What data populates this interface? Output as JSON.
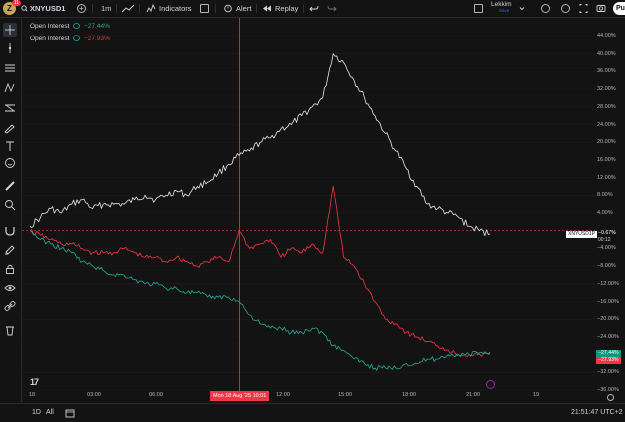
{
  "toolbar": {
    "logo_letter": "Z",
    "notification_count": "11",
    "symbol": "XNYUSD1",
    "add_symbol": "+",
    "interval": "1m",
    "indicators_label": "Indicators",
    "alert_label": "Alert",
    "replay_label": "Replay",
    "layout_name": "Lekkim",
    "layout_status": "Save",
    "publish_label": "Pu"
  },
  "legend": [
    {
      "name": "Open Interest",
      "value": "−27.44%",
      "color": "#22ab94"
    },
    {
      "name": "Open Interest",
      "value": "−27.93%",
      "color": "#f23645"
    }
  ],
  "price_scale": {
    "ticks": [
      "44.00%",
      "40.00%",
      "36.00%",
      "32.00%",
      "28.00%",
      "24.00%",
      "20.00%",
      "16.00%",
      "12.00%",
      "8.00%",
      "4.00%",
      "−4.00%",
      "−8.00%",
      "−12.00%",
      "−16.00%",
      "−20.00%",
      "−24.00%",
      "−32.00%",
      "−36.00%"
    ],
    "symbol_tag": "XNYUSD1P",
    "symbol_value": "−0.67%",
    "countdown": "00:12",
    "tag_green": "−27.44%",
    "tag_red": "−27.93%"
  },
  "time_scale": {
    "ticks": [
      "18",
      "03:00",
      "06:00",
      "12:00",
      "15:00",
      "18:00",
      "21:00",
      "19"
    ],
    "crosshair_label": "Mon 18 Aug '25   10:01"
  },
  "bottom": {
    "range_1d": "1D",
    "range_all": "All",
    "clock": "21:51:47 UTC+2"
  },
  "colors": {
    "background": "#131313",
    "white_series": "#e8e8e8",
    "red_series": "#f23645",
    "green_series": "#22ab94",
    "crosshair": "#f23645"
  },
  "chart_data": {
    "type": "line",
    "x": [
      "00:00",
      "00:30",
      "01:00",
      "01:30",
      "02:00",
      "02:30",
      "03:00",
      "03:30",
      "04:00",
      "04:30",
      "05:00",
      "05:30",
      "06:00",
      "06:30",
      "07:00",
      "07:30",
      "08:00",
      "08:30",
      "09:00",
      "09:30",
      "10:00",
      "10:30",
      "11:00",
      "11:30",
      "12:00",
      "12:30",
      "13:00",
      "13:30",
      "14:00",
      "14:30",
      "15:00",
      "15:30",
      "16:00",
      "16:30",
      "17:00",
      "17:30",
      "18:00",
      "18:30",
      "19:00",
      "19:30",
      "20:00",
      "20:30",
      "21:00",
      "21:30",
      "21:50"
    ],
    "series": [
      {
        "name": "XNYUSD1",
        "color": "#e8e8e8",
        "values": [
          1,
          3,
          5,
          4,
          6,
          7,
          5,
          6,
          6,
          6,
          7,
          8,
          7,
          8,
          9,
          8,
          10,
          11,
          13,
          15,
          17,
          18,
          20,
          21,
          23,
          24,
          26,
          28,
          30,
          40,
          38,
          34,
          30,
          26,
          22,
          18,
          14,
          10,
          6,
          5,
          4,
          3,
          1,
          0,
          -0.7
        ]
      },
      {
        "name": "Open Interest",
        "color": "#f23645",
        "values": [
          0,
          -1,
          -2,
          -3,
          -3,
          -4,
          -5,
          -5,
          -5,
          -4,
          -5,
          -6,
          -6,
          -7,
          -6,
          -7,
          -8,
          -7,
          -6,
          -7,
          0,
          -4,
          -3,
          -2,
          -6,
          -4,
          -5,
          -3,
          -5,
          10,
          -6,
          -8,
          -12,
          -16,
          -20,
          -21,
          -23,
          -24,
          -25,
          -26,
          -27,
          -28,
          -28,
          -28,
          -27.93
        ]
      },
      {
        "name": "Open Interest",
        "color": "#22ab94",
        "values": [
          0,
          -2,
          -3,
          -4,
          -5,
          -7,
          -8,
          -9,
          -10,
          -10,
          -11,
          -12,
          -12,
          -13,
          -13,
          -14,
          -14,
          -15,
          -15,
          -15,
          -16,
          -19,
          -21,
          -22,
          -22,
          -23,
          -23,
          -22,
          -23,
          -26,
          -27,
          -29,
          -30,
          -31,
          -31,
          -31,
          -30,
          -30,
          -29,
          -29,
          -28,
          -28,
          -28,
          -27.6,
          -27.44
        ]
      }
    ],
    "ylim": [
      -36,
      44
    ],
    "grid": true,
    "legend": "top-left"
  }
}
